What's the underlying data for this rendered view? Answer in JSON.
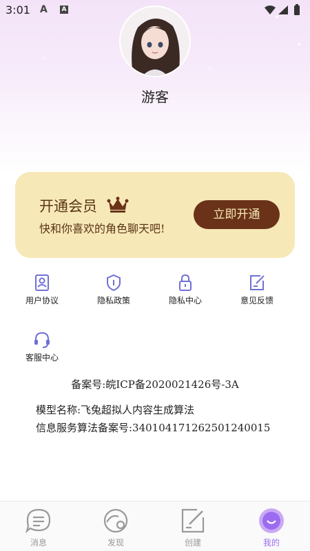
{
  "status_bar": {
    "time": "3:01",
    "icon_a": "A",
    "icon_b": "A"
  },
  "profile": {
    "username": "游客"
  },
  "vip_card": {
    "title": "开通会员",
    "subtitle": "快和你喜欢的角色聊天吧!",
    "button_label": "立即开通",
    "card_color": "#f7e8b8",
    "button_color": "#6a3319"
  },
  "menu": {
    "items": [
      {
        "label": "用户协议",
        "icon": "user-id-icon"
      },
      {
        "label": "隐私政策",
        "icon": "shield-icon"
      },
      {
        "label": "隐私中心",
        "icon": "lock-icon"
      },
      {
        "label": "意见反馈",
        "icon": "edit-icon"
      },
      {
        "label": "客服中心",
        "icon": "headset-icon"
      }
    ]
  },
  "info": {
    "icp": "备案号:皖ICP备2020021426号-3A",
    "model_name": "模型名称:飞兔超拟人内容生成算法",
    "algorithm_record": "信息服务算法备案号:340104171262501240015"
  },
  "tabbar": {
    "accent_color": "#9b6cf0",
    "tabs": [
      {
        "label": "消息",
        "icon": "chat-icon"
      },
      {
        "label": "发现",
        "icon": "discover-icon"
      },
      {
        "label": "创建",
        "icon": "create-icon"
      },
      {
        "label": "我的",
        "icon": "profile-icon",
        "active": true
      }
    ]
  }
}
